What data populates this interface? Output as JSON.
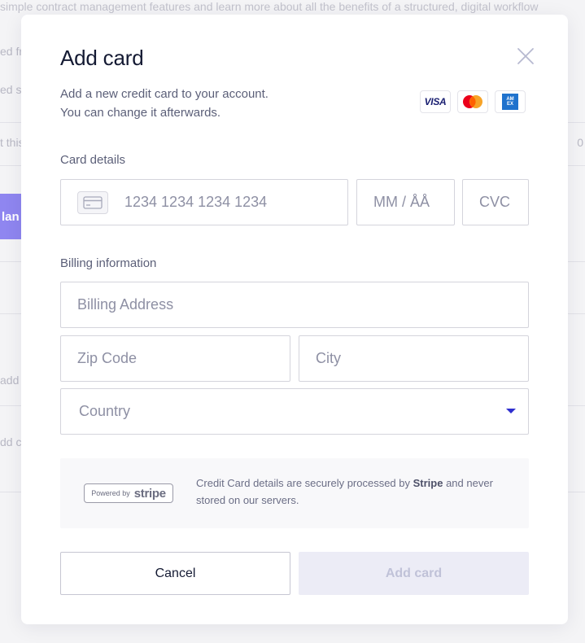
{
  "background": {
    "top_text": "simple contract management features and learn more about all the benefits of a structured, digital workflow",
    "fragments": [
      "ed fr",
      "ed st",
      "t this",
      "lan",
      "add",
      "dd c"
    ],
    "right_fragment": "0"
  },
  "modal": {
    "title": "Add card",
    "subtitle_line1": "Add a new credit card to your account.",
    "subtitle_line2": "You can change it afterwards.",
    "brands": {
      "visa": "VISA",
      "amex_top": "AM",
      "amex_bottom": "EX"
    },
    "card_details_label": "Card details",
    "card_number_placeholder": "1234 1234 1234 1234",
    "expiry_placeholder": "MM / ÅÅ",
    "cvc_placeholder": "CVC",
    "billing_label": "Billing information",
    "billing_address_placeholder": "Billing Address",
    "zip_placeholder": "Zip Code",
    "city_placeholder": "City",
    "country_label": "Country",
    "stripe": {
      "powered_by": "Powered by",
      "wordmark": "stripe",
      "note_before": "Credit Card details are securely processed by ",
      "note_brand": "Stripe",
      "note_after": " and never stored on our servers."
    },
    "cancel_label": "Cancel",
    "add_label": "Add card"
  },
  "colors": {
    "accent": "#2f2fcf",
    "disabled_button_bg": "#ececf6",
    "background_button": "#8f86f0",
    "mastercard_red": "#eb001b",
    "mastercard_orange": "#f79e1b",
    "amex_blue": "#1f72cd"
  }
}
